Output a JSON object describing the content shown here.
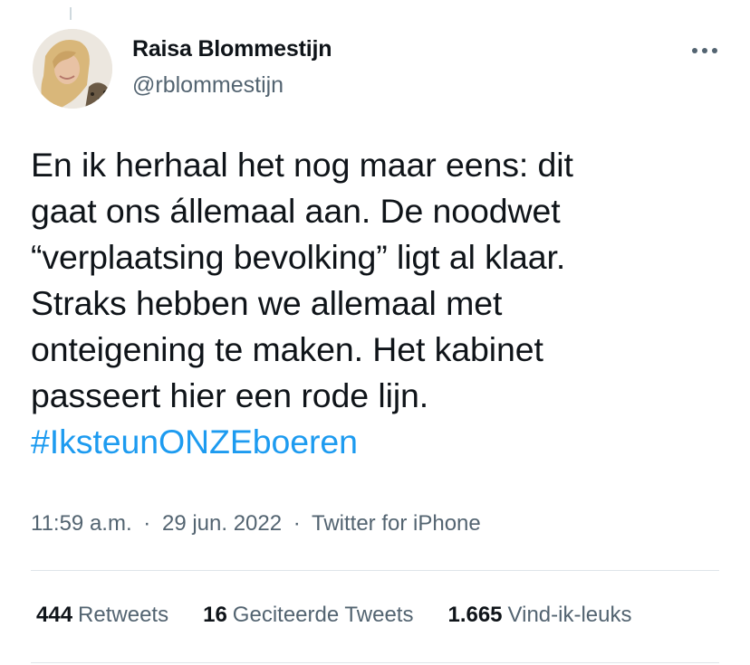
{
  "author": {
    "name": "Raisa Blommestijn",
    "handle": "@rblommestijn",
    "avatar": "profile-photo"
  },
  "tweet": {
    "lines": [
      "En ik herhaal het nog maar eens: dit",
      "gaat ons állemaal aan. De noodwet",
      "“verplaatsing bevolking” ligt al klaar.",
      "Straks hebben we allemaal met",
      "onteigening te maken. Het kabinet",
      "passeert hier een rode lijn."
    ],
    "hashtag": "#IksteunONZEboeren"
  },
  "meta": {
    "time": "11:59 a.m.",
    "separator": "·",
    "date": "29 jun. 2022",
    "source": "Twitter for iPhone"
  },
  "stats": {
    "retweets": {
      "count": "444",
      "label": "Retweets"
    },
    "quotes": {
      "count": "16",
      "label": "Geciteerde Tweets"
    },
    "likes": {
      "count": "1.665",
      "label": "Vind-ik-leuks"
    }
  },
  "colors": {
    "text": "#0f1419",
    "secondary": "#536471",
    "link": "#1d9bf0",
    "divider": "#dfe5e9"
  },
  "icons": {
    "more": "more-dots-icon"
  }
}
